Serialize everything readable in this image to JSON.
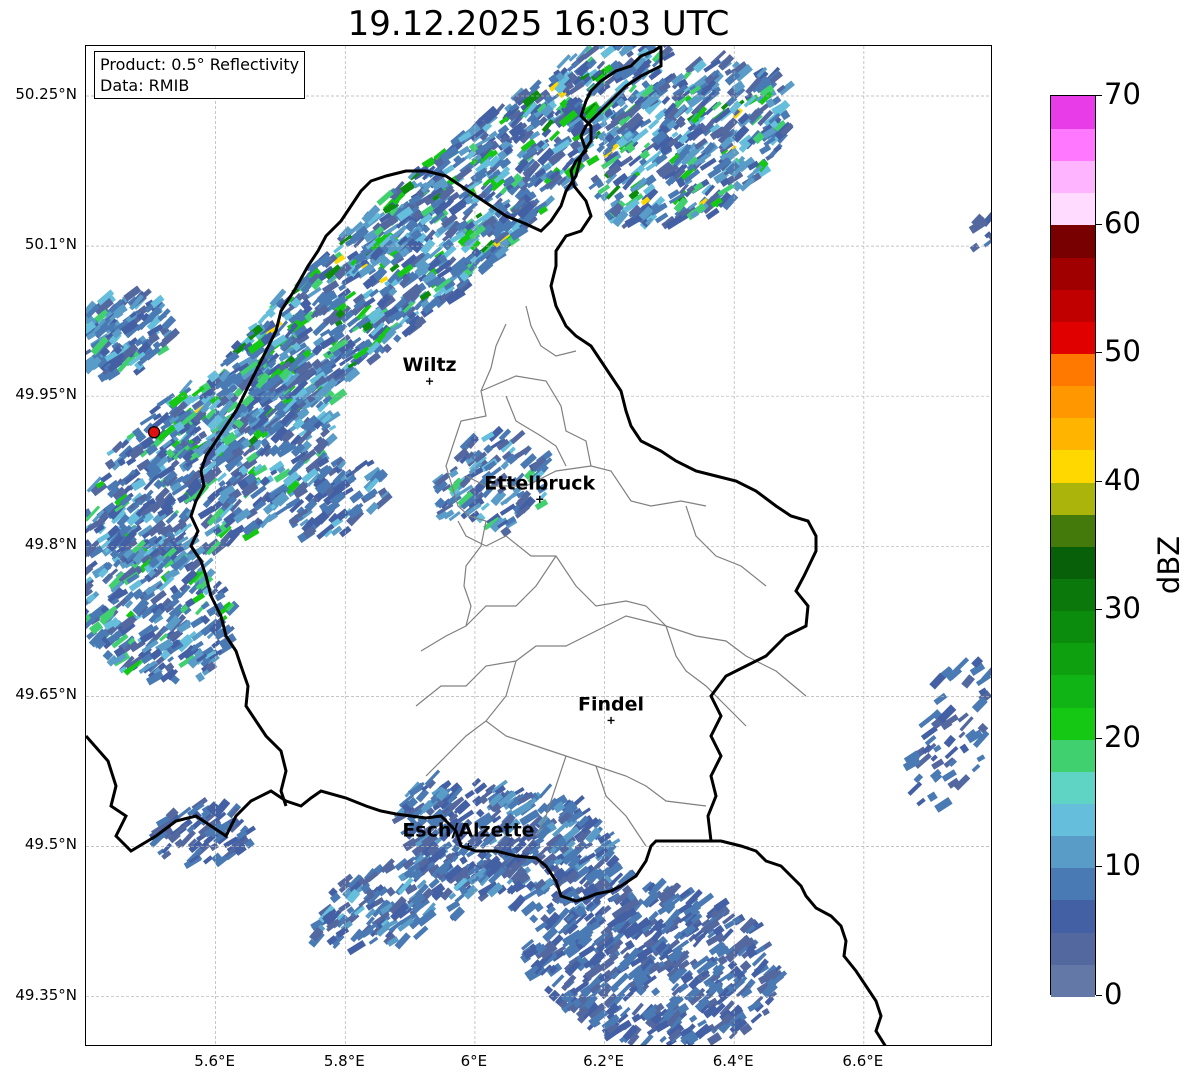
{
  "title": "19.12.2025 16:03 UTC",
  "info": {
    "product": "Product: 0.5° Reflectivity",
    "data_source": "Data: RMIB"
  },
  "latitude_ticks": [
    "50.25°N",
    "50.1°N",
    "49.95°N",
    "49.8°N",
    "49.65°N",
    "49.5°N",
    "49.35°N"
  ],
  "longitude_ticks": [
    "5.6°E",
    "5.8°E",
    "6°E",
    "6.2°E",
    "6.4°E",
    "6.6°E"
  ],
  "cities": [
    {
      "name": "Wiltz",
      "lon": 5.93,
      "lat": 49.965
    },
    {
      "name": "Ettelbruck",
      "lon": 6.1,
      "lat": 49.847
    },
    {
      "name": "Findel",
      "lon": 6.21,
      "lat": 49.626
    },
    {
      "name": "Esch/Alzette",
      "lon": 5.99,
      "lat": 49.5
    }
  ],
  "radar_site": {
    "lon": 5.505,
    "lat": 49.914
  },
  "colorbar": {
    "label": "dBZ",
    "ticks": [
      "0",
      "10",
      "20",
      "30",
      "40",
      "50",
      "60",
      "70"
    ],
    "min": 0,
    "max": 70,
    "step": 2.5,
    "colors": [
      "#6478a8",
      "#5468a0",
      "#4460a4",
      "#4a7ab4",
      "#5a9cc8",
      "#64bedc",
      "#60d4c4",
      "#40d070",
      "#14c814",
      "#10b414",
      "#0ea00e",
      "#0c8c0c",
      "#0a780a",
      "#086008",
      "#447a0c",
      "#aab40a",
      "#ffd800",
      "#ffb400",
      "#ff9800",
      "#ff7800",
      "#e00000",
      "#c00000",
      "#a00000",
      "#780000",
      "#ffdcff",
      "#ffb4ff",
      "#ff78ff",
      "#e83ce8"
    ]
  },
  "map_bounds": {
    "lon_min": 5.4,
    "lon_max": 6.8,
    "lat_min": 49.3,
    "lat_max": 50.3
  },
  "colors": {
    "border": "#000000",
    "canton_border": "#808080",
    "grid": "#b0b0b0",
    "radar_marker": "#e01010"
  }
}
